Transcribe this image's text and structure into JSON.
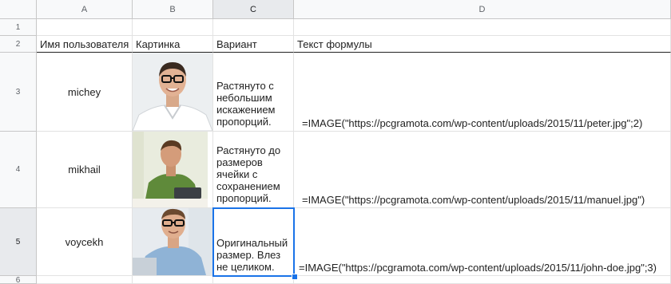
{
  "columns": [
    "A",
    "B",
    "C",
    "D"
  ],
  "rows": [
    "1",
    "2",
    "3",
    "4",
    "5",
    "6"
  ],
  "headers": {
    "a": "Имя пользователя",
    "b": "Картинка",
    "c": "Вариант",
    "d": "Текст формулы"
  },
  "data": [
    {
      "name": "michey",
      "variant": "Растянуто с небольшим искажением пропорций.",
      "formula": "=IMAGE(\"https://pcgramota.com/wp-content/uploads/2015/11/peter.jpg\";2)"
    },
    {
      "name": "mikhail",
      "variant": "Растянуто до размеров ячейки с сохранением пропорций.",
      "formula": "=IMAGE(\"https://pcgramota.com/wp-content/uploads/2015/11/manuel.jpg\")"
    },
    {
      "name": "voycekh",
      "variant": "Оригинальный размер. Влез не целиком.",
      "formula": "=IMAGE(\"https://pcgramota.com/wp-content/uploads/2015/11/john-doe.jpg\";3)"
    }
  ],
  "selected_cell": "C5",
  "colors": {
    "selection": "#1a73e8",
    "header_bg": "#f8f9fa",
    "grid": "#e2e2e2"
  }
}
